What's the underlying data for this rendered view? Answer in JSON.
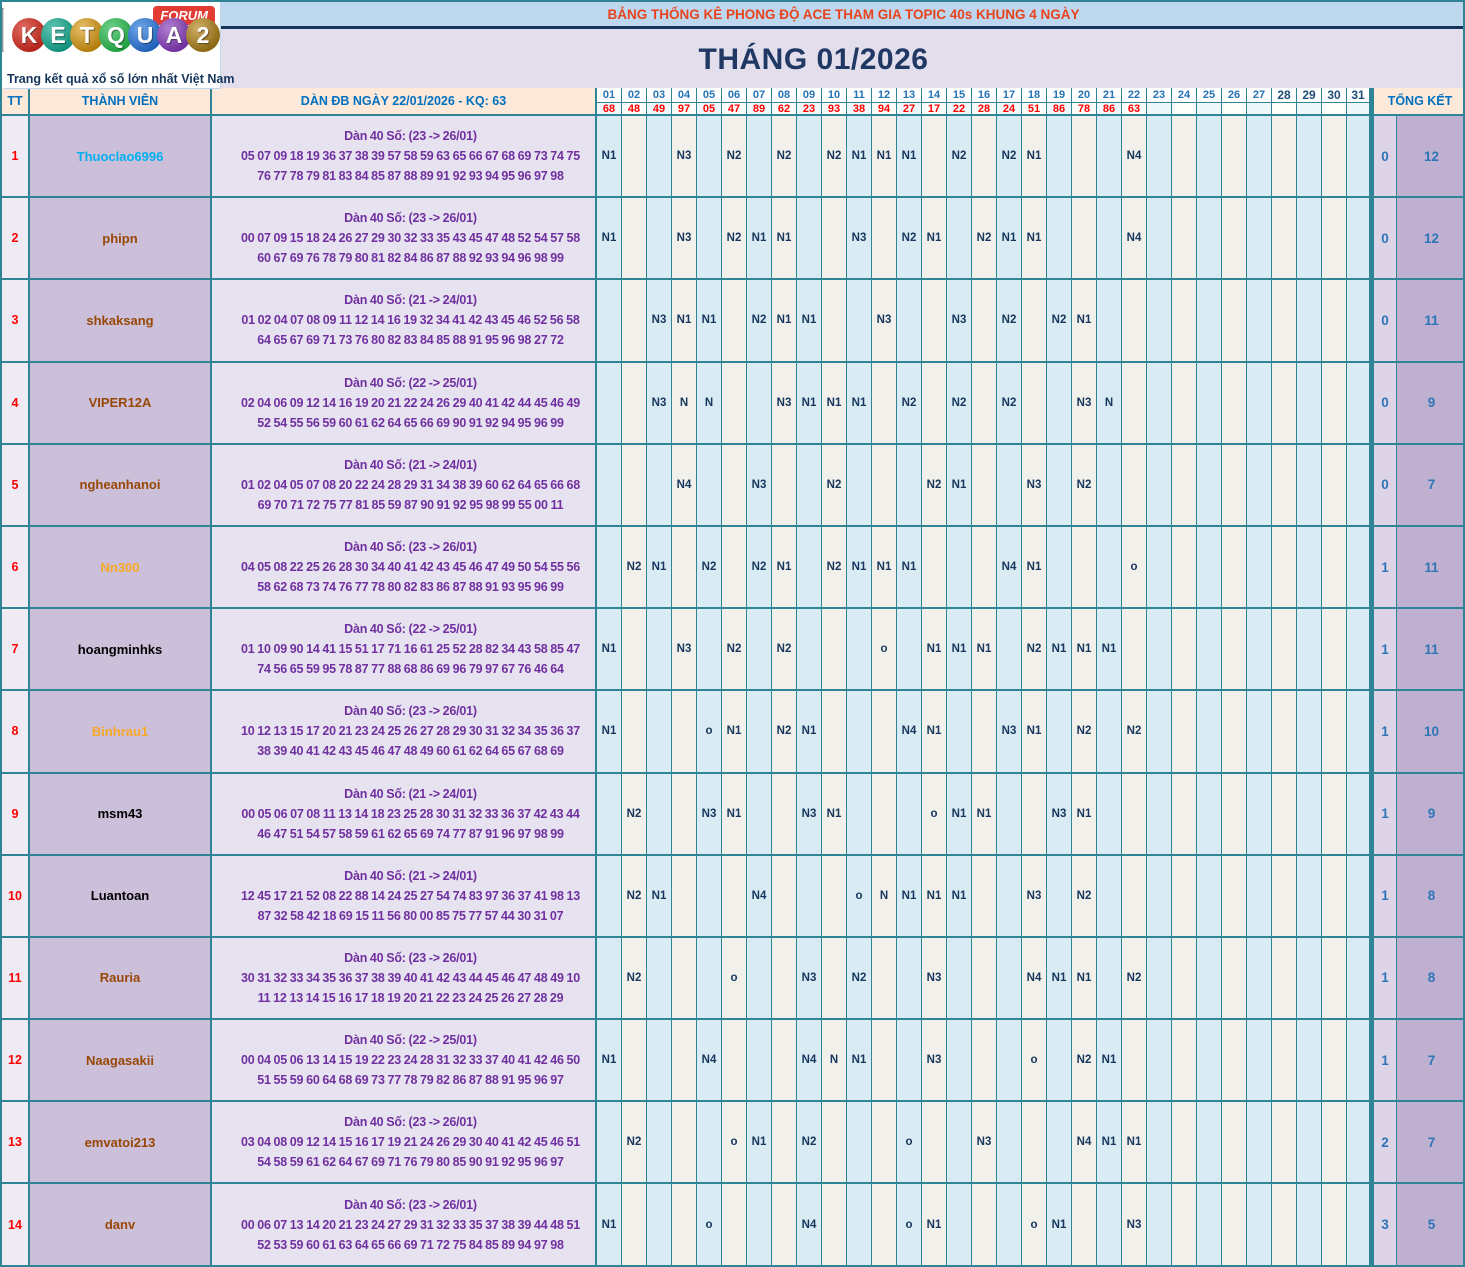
{
  "logo": {
    "letters": [
      {
        "ch": "K",
        "color": "#b22318",
        "light": "#e06a5f"
      },
      {
        "ch": "E",
        "color": "#0e8f7a",
        "light": "#5fc4b0"
      },
      {
        "ch": "T",
        "color": "#b07c08",
        "light": "#e8c06a"
      },
      {
        "ch": "Q",
        "color": "#1e9e3f",
        "light": "#6fd08a"
      },
      {
        "ch": "U",
        "color": "#1f5fb8",
        "light": "#6fa8e8"
      },
      {
        "ch": "A",
        "color": "#6f2f9e",
        "light": "#b07fd0"
      },
      {
        "ch": "2",
        "color": "#8a660f",
        "light": "#d0b06a"
      }
    ],
    "forum_label": "FORUM",
    "tagline": "Trang kết quả xổ số lớn nhất Việt Nam"
  },
  "banner": {
    "title": "BẢNG THỐNG KÊ PHONG ĐỘ ACE THAM GIA TOPIC 40s KHUNG 4 NGÀY"
  },
  "month_title": "THÁNG 01/2026",
  "table": {
    "headers": {
      "tt": "TT",
      "member": "THÀNH VIÊN",
      "dan": "DÀN ĐB NGÀY 22/01/2026 - KQ: 63",
      "total": "TỔNG KẾT"
    },
    "days": [
      "01",
      "02",
      "03",
      "04",
      "05",
      "06",
      "07",
      "08",
      "09",
      "10",
      "11",
      "12",
      "13",
      "14",
      "15",
      "16",
      "17",
      "18",
      "19",
      "20",
      "21",
      "22",
      "23",
      "24",
      "25",
      "26",
      "27",
      "28",
      "29",
      "30",
      "31"
    ],
    "kq": [
      "68",
      "48",
      "49",
      "97",
      "05",
      "47",
      "89",
      "62",
      "23",
      "93",
      "38",
      "94",
      "27",
      "17",
      "22",
      "28",
      "24",
      "51",
      "86",
      "78",
      "86",
      "63",
      "",
      "",
      "",
      "",
      "",
      "",
      "",
      "",
      ""
    ],
    "rows": [
      {
        "tt": "1",
        "member": "Thuoclao6996",
        "color": "#00b0f0",
        "dan_title": "Dàn 40 Số: (23 -> 26/01)",
        "dan_line1": "05 07 09 18 19 36 37 38 39 57 58 59 63 65 66 67 68 69 73 74 75",
        "dan_line2": "76 77 78 79 81 83 84 85 87 88 89 91 92 93 94 95 96 97 98",
        "marks": {
          "1": "N1",
          "4": "N3",
          "6": "N2",
          "8": "N2",
          "10": "N2",
          "11": "N1",
          "12": "N1",
          "13": "N1",
          "15": "N2",
          "17": "N2",
          "18": "N1",
          "22": "N4"
        },
        "miss": "0",
        "hit": "12"
      },
      {
        "tt": "2",
        "member": "phipn",
        "color": "#974706",
        "dan_title": "Dàn 40 Số: (23 -> 26/01)",
        "dan_line1": "00 07 09 15 18 24 26 27 29 30 32 33 35 43 45 47 48 52 54 57 58",
        "dan_line2": "60 67 69 76 78 79 80 81 82 84 86 87 88 92 93 94 96 98 99",
        "marks": {
          "1": "N1",
          "4": "N3",
          "6": "N2",
          "7": "N1",
          "8": "N1",
          "11": "N3",
          "13": "N2",
          "14": "N1",
          "16": "N2",
          "17": "N1",
          "18": "N1",
          "22": "N4"
        },
        "miss": "0",
        "hit": "12"
      },
      {
        "tt": "3",
        "member": "shkaksang",
        "color": "#974706",
        "dan_title": "Dàn 40 Số: (21 -> 24/01)",
        "dan_line1": "01 02 04 07 08 09 11 12 14 16 19 32 34 41 42 43 45 46 52 56 58",
        "dan_line2": "64 65 67 69 71 73 76 80 82 83 84 85 88 91 95 96 98 27 72",
        "marks": {
          "3": "N3",
          "4": "N1",
          "5": "N1",
          "7": "N2",
          "8": "N1",
          "9": "N1",
          "12": "N3",
          "15": "N3",
          "17": "N2",
          "19": "N2",
          "20": "N1"
        },
        "miss": "0",
        "hit": "11"
      },
      {
        "tt": "4",
        "member": "VIPER12A",
        "color": "#974706",
        "dan_title": "Dàn 40 Số: (22 -> 25/01)",
        "dan_line1": "02 04 06 09 12 14 16 19 20 21 22 24 26 29 40 41 42 44 45 46 49",
        "dan_line2": "52 54 55 56 59 60 61 62 64 65 66 69 90 91 92 94 95 96 99",
        "marks": {
          "3": "N3",
          "4": "N",
          "5": "N",
          "8": "N3",
          "9": "N1",
          "10": "N1",
          "11": "N1",
          "13": "N2",
          "15": "N2",
          "17": "N2",
          "20": "N3",
          "21": "N"
        },
        "miss": "0",
        "hit": "9"
      },
      {
        "tt": "5",
        "member": "ngheanhanoi",
        "color": "#974706",
        "dan_title": "Dàn 40 Số: (21 -> 24/01)",
        "dan_line1": "01 02 04 05 07 08 20 22 24 28 29 31 34 38 39 60 62 64 65 66 68",
        "dan_line2": "69 70 71 72 75 77 81 85 59 87 90 91 92 95 98 99 55 00 11",
        "marks": {
          "4": "N4",
          "7": "N3",
          "10": "N2",
          "14": "N2",
          "15": "N1",
          "18": "N3",
          "20": "N2"
        },
        "miss": "0",
        "hit": "7"
      },
      {
        "tt": "6",
        "member": "Nn300",
        "color": "#f9a825",
        "dan_title": "Dàn 40 Số: (23 -> 26/01)",
        "dan_line1": "04 05 08 22 25 26 28 30 34 40 41 42 43 45 46 47 49 50 54 55 56",
        "dan_line2": "58 62 68 73 74 76 77 78 80 82 83 86 87 88 91 93 95 96 99",
        "marks": {
          "2": "N2",
          "3": "N1",
          "5": "N2",
          "7": "N2",
          "8": "N1",
          "10": "N2",
          "11": "N1",
          "12": "N1",
          "13": "N1",
          "17": "N4",
          "18": "N1",
          "22": "o"
        },
        "miss": "1",
        "hit": "11"
      },
      {
        "tt": "7",
        "member": "hoangminhks",
        "color": "#000000",
        "dan_title": "Dàn 40 Số: (22 -> 25/01)",
        "dan_line1": "01 10 09 90 14 41 15 51 17 71 16 61 25 52 28 82 34 43 58 85 47",
        "dan_line2": "74 56 65 59 95 78 87 77 88 68 86 69 96 79 97 67 76 46 64",
        "marks": {
          "1": "N1",
          "4": "N3",
          "6": "N2",
          "8": "N2",
          "12": "o",
          "14": "N1",
          "15": "N1",
          "16": "N1",
          "18": "N2",
          "19": "N1",
          "20": "N1",
          "21": "N1"
        },
        "miss": "1",
        "hit": "11"
      },
      {
        "tt": "8",
        "member": "Binhrau1",
        "color": "#f9a825",
        "dan_title": "Dàn 40 Số: (23 -> 26/01)",
        "dan_line1": "10 12 13 15 17 20 21 23 24 25 26 27 28 29 30 31 32 34 35 36 37",
        "dan_line2": "38 39 40 41 42 43 45 46 47 48 49 60 61 62 64 65 67 68 69",
        "marks": {
          "1": "N1",
          "5": "o",
          "6": "N1",
          "8": "N2",
          "9": "N1",
          "13": "N4",
          "14": "N1",
          "17": "N3",
          "18": "N1",
          "20": "N2",
          "22": "N2"
        },
        "miss": "1",
        "hit": "10"
      },
      {
        "tt": "9",
        "member": "msm43",
        "color": "#000000",
        "dan_title": "Dàn 40 Số: (21 -> 24/01)",
        "dan_line1": "00 05 06 07 08 11 13 14 18 23 25 28 30 31 32 33 36 37 42 43 44",
        "dan_line2": "46 47 51 54 57 58 59 61 62 65 69 74 77 87 91 96 97 98 99",
        "marks": {
          "2": "N2",
          "5": "N3",
          "6": "N1",
          "9": "N3",
          "10": "N1",
          "14": "o",
          "15": "N1",
          "16": "N1",
          "19": "N3",
          "20": "N1"
        },
        "miss": "1",
        "hit": "9"
      },
      {
        "tt": "10",
        "member": "Luantoan",
        "color": "#000000",
        "dan_title": "Dàn 40 Số: (21 -> 24/01)",
        "dan_line1": "12 45 17 21 52 08 22 88 14 24 25 27 54 74 83 97 36 37 41 98 13",
        "dan_line2": "87 32 58 42 18 69 15 11 56 80 00 85 75 77 57 44 30 31 07",
        "marks": {
          "2": "N2",
          "3": "N1",
          "7": "N4",
          "11": "o",
          "12": "N",
          "13": "N1",
          "14": "N1",
          "15": "N1",
          "18": "N3",
          "20": "N2"
        },
        "miss": "1",
        "hit": "8"
      },
      {
        "tt": "11",
        "member": "Rauria",
        "color": "#974706",
        "dan_title": "Dàn 40 Số: (23 -> 26/01)",
        "dan_line1": "30 31 32 33 34 35 36 37 38 39 40 41 42 43 44 45 46 47 48 49 10",
        "dan_line2": "11 12 13 14 15 16 17 18 19 20 21 22 23 24 25 26 27 28 29",
        "marks": {
          "2": "N2",
          "6": "o",
          "9": "N3",
          "11": "N2",
          "14": "N3",
          "18": "N4",
          "19": "N1",
          "20": "N1",
          "22": "N2"
        },
        "miss": "1",
        "hit": "8"
      },
      {
        "tt": "12",
        "member": "Naagasakii",
        "color": "#974706",
        "dan_title": "Dàn 40 Số: (22 -> 25/01)",
        "dan_line1": "00 04 05 06 13 14 15 19 22 23 24 28 31 32 33 37 40 41 42 46 50",
        "dan_line2": "51 55 59 60 64 68 69 73 77 78 79 82 86 87 88 91 95 96 97",
        "marks": {
          "1": "N1",
          "5": "N4",
          "9": "N4",
          "10": "N",
          "11": "N1",
          "14": "N3",
          "18": "o",
          "20": "N2",
          "21": "N1"
        },
        "miss": "1",
        "hit": "7"
      },
      {
        "tt": "13",
        "member": "emvatoi213",
        "color": "#974706",
        "dan_title": "Dàn 40 Số: (23 -> 26/01)",
        "dan_line1": "03 04 08 09 12 14 15 16 17 19 21 24 26 29 30 40 41 42 45 46 51",
        "dan_line2": "54 58 59 61 62 64 67 69 71 76 79 80 85 90 91 92 95 96 97",
        "marks": {
          "2": "N2",
          "6": "o",
          "7": "N1",
          "9": "N2",
          "13": "o",
          "16": "N3",
          "20": "N4",
          "21": "N1",
          "22": "N1"
        },
        "miss": "2",
        "hit": "7"
      },
      {
        "tt": "14",
        "member": "danv",
        "color": "#974706",
        "dan_title": "Dàn 40 Số: (23 -> 26/01)",
        "dan_line1": "00 06 07 13 14 20 21 23 24 27 29 31 32 33 35 37 38 39 44 48 51",
        "dan_line2": "52 53 59 60 61 63 64 65 66 69 71 72 75 84 85 89 94 97 98",
        "marks": {
          "1": "N1",
          "5": "o",
          "9": "N4",
          "13": "o",
          "14": "N1",
          "18": "o",
          "19": "N1",
          "22": "N3"
        },
        "miss": "3",
        "hit": "5"
      }
    ]
  }
}
